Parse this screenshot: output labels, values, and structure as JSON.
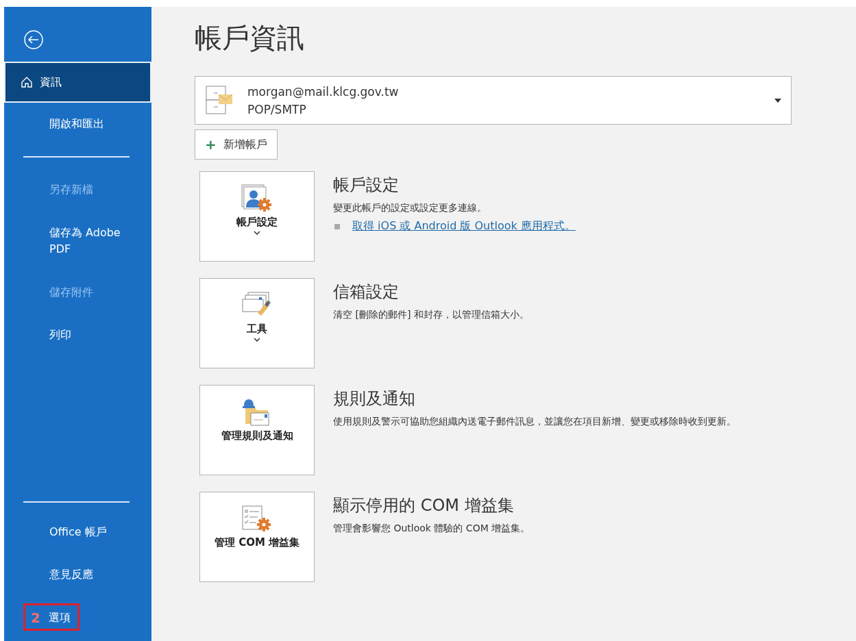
{
  "sidebar": {
    "top_items": [
      {
        "kind": "home",
        "label": "資訊",
        "selected": true,
        "disabled": false
      },
      {
        "kind": "item",
        "label": "開啟和匯出",
        "selected": false,
        "disabled": false
      },
      {
        "kind": "divider"
      },
      {
        "kind": "item",
        "label": "另存新檔",
        "selected": false,
        "disabled": true
      },
      {
        "kind": "item",
        "label": "儲存為 Adobe PDF",
        "selected": false,
        "disabled": false
      },
      {
        "kind": "item",
        "label": "儲存附件",
        "selected": false,
        "disabled": true
      },
      {
        "kind": "item",
        "label": "列印",
        "selected": false,
        "disabled": false
      }
    ],
    "bottom_items": [
      {
        "kind": "divider"
      },
      {
        "kind": "item",
        "label": "Office 帳戶",
        "selected": false,
        "disabled": false
      },
      {
        "kind": "item",
        "label": "意見反應",
        "selected": false,
        "disabled": false
      },
      {
        "kind": "item",
        "label": "選項",
        "selected": false,
        "disabled": false,
        "annotation": {
          "number": "2"
        }
      }
    ]
  },
  "page_title": "帳戶資訊",
  "account": {
    "email": "morgan@mail.klcg.gov.tw",
    "type": "POP/SMTP"
  },
  "add_account_button": {
    "icon_text": "+",
    "label": "新增帳戶"
  },
  "sections": [
    {
      "kind": "account",
      "button_label": "帳戶設定",
      "has_dropdown": true,
      "title": "帳戶設定",
      "description": "變更此帳戶的設定或設定更多連線。",
      "links": [
        "取得 iOS 或 Android 版 Outlook 應用程式。"
      ]
    },
    {
      "kind": "tools",
      "button_label": "工具",
      "has_dropdown": true,
      "title": "信箱設定",
      "description": "清空 [刪除的郵件] 和封存，以管理信箱大小。"
    },
    {
      "kind": "rules",
      "button_label": "管理規則及通知",
      "has_dropdown": false,
      "title": "規則及通知",
      "description": "使用規則及警示可協助您組織內送電子郵件訊息，並讓您在項目新增、變更或移除時收到更新。"
    },
    {
      "kind": "com",
      "button_label": "管理 COM 增益集",
      "has_dropdown": false,
      "title": "顯示停用的 COM 增益集",
      "description": "管理會影響您 Outlook 體驗的 COM 增益集。"
    }
  ]
}
